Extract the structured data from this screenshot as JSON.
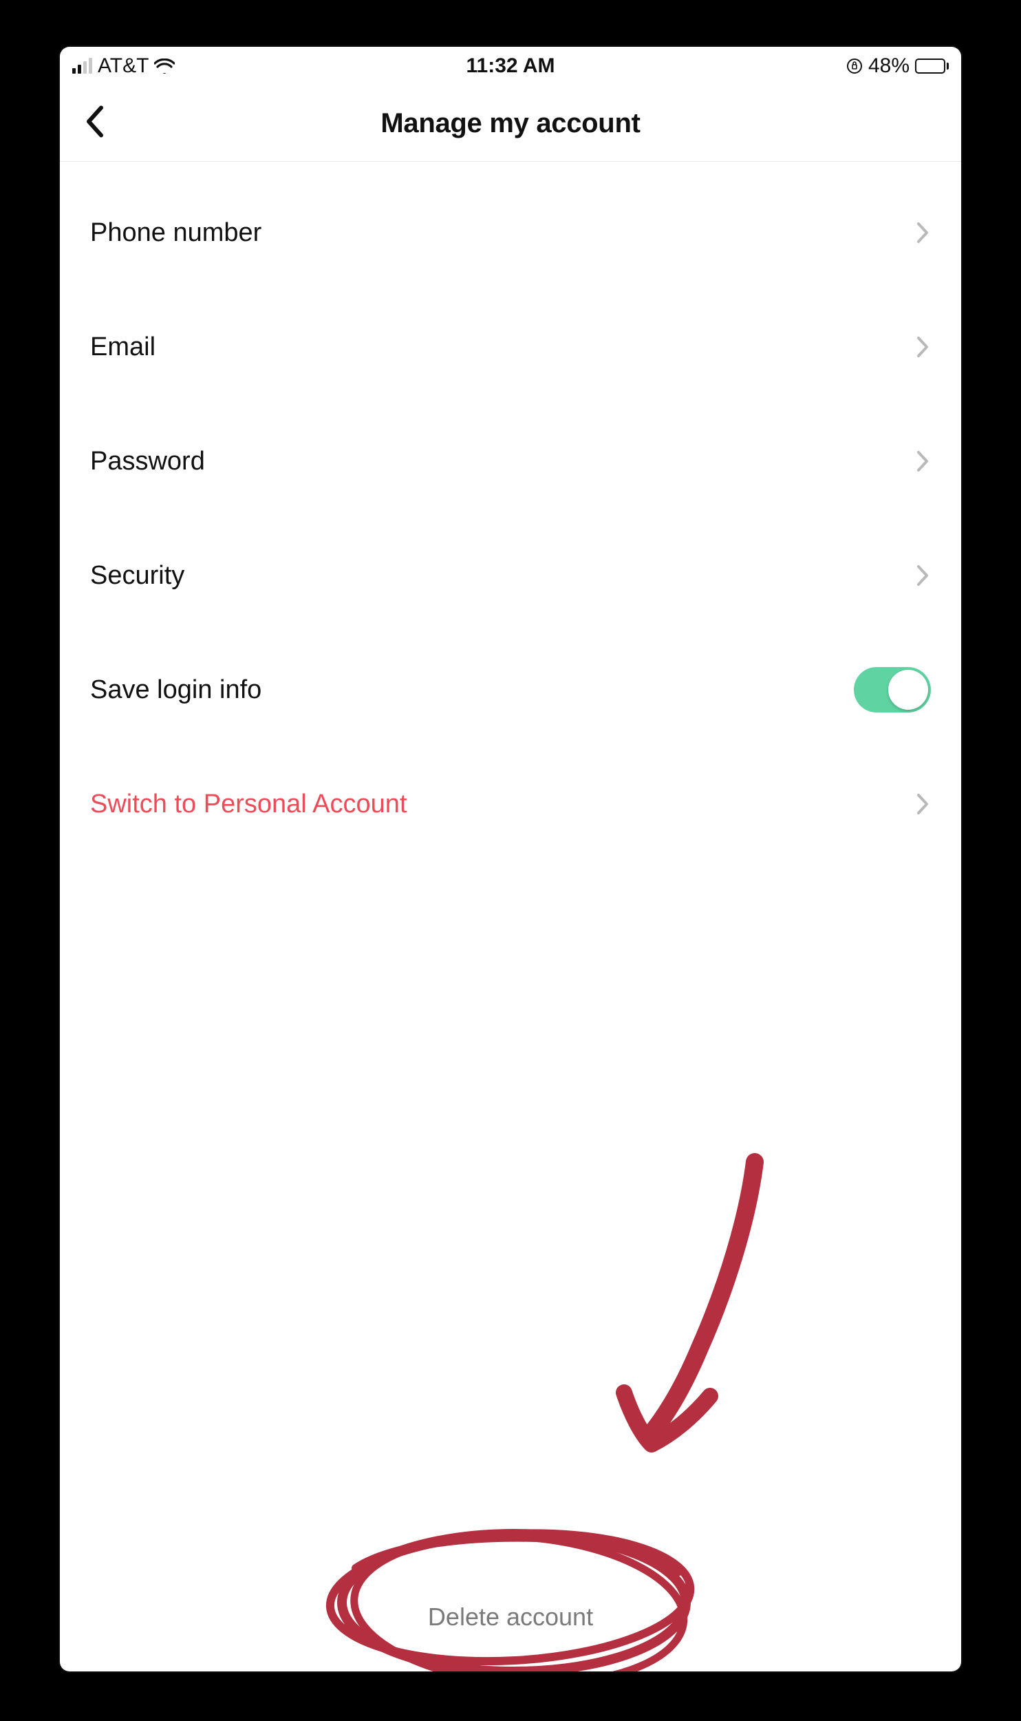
{
  "status": {
    "carrier": "AT&T",
    "time": "11:32 AM",
    "battery_pct": "48%"
  },
  "header": {
    "title": "Manage my account"
  },
  "rows": {
    "phone": "Phone number",
    "email": "Email",
    "password": "Password",
    "security": "Security",
    "save_login": "Save login info",
    "switch_account": "Switch to Personal Account"
  },
  "toggles": {
    "save_login_on": true
  },
  "footer": {
    "delete": "Delete account"
  },
  "annotation": {
    "color": "#b42f3f"
  }
}
